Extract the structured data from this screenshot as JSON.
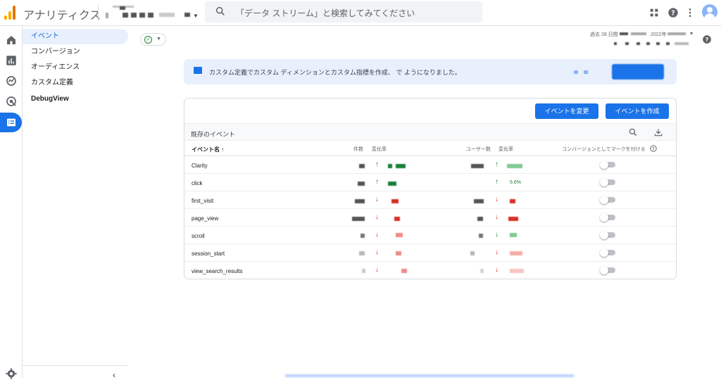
{
  "header": {
    "app_title": "アナリティクス",
    "search_placeholder": "「データ ストリーム」と検索してみてください"
  },
  "sidebar": {
    "items": [
      {
        "label": "イベント",
        "active": true
      },
      {
        "label": "コンバージョン",
        "active": false
      },
      {
        "label": "オーディエンス",
        "active": false
      },
      {
        "label": "カスタム定義",
        "active": false
      },
      {
        "label": "DebugView",
        "active": false
      }
    ]
  },
  "date_range": {
    "prefix": "過去 28 日間",
    "year_fragment": "2022年"
  },
  "banner": {
    "text": "カスタム定義でカスタム ディメンションとカスタム指標を作成、 で ようになりました。"
  },
  "card": {
    "modify_button": "イベントを変更",
    "create_button": "イベントを作成",
    "section_title": "既存のイベント",
    "columns": {
      "name": "イベント名 ↑",
      "count": "件数",
      "change1": "変化率",
      "users": "ユーザー数",
      "change2": "変化率",
      "conversion": "コンバージョンとしてマークを付ける"
    },
    "rows": [
      {
        "name": "Clarity",
        "trend": "up",
        "user_pct": ""
      },
      {
        "name": "click",
        "trend": "up",
        "user_pct": "5.6%"
      },
      {
        "name": "first_visit",
        "trend": "down",
        "user_pct": ""
      },
      {
        "name": "page_view",
        "trend": "down",
        "user_pct": ""
      },
      {
        "name": "scroll",
        "trend": "down",
        "user_pct": ""
      },
      {
        "name": "session_start",
        "trend": "down",
        "user_pct": ""
      },
      {
        "name": "view_search_results",
        "trend": "down",
        "user_pct": ""
      }
    ]
  },
  "colors": {
    "accent": "#1a73e8",
    "up": "#188038",
    "down": "#d93025",
    "logo": "#f9ab00"
  }
}
